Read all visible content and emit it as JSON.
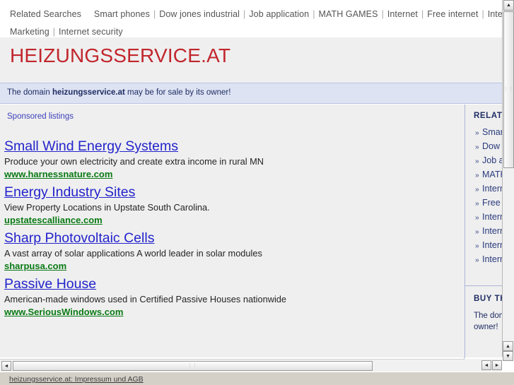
{
  "related_bar": {
    "label": "Related Searches",
    "items": [
      "Smart phones",
      "Dow jones industrial",
      "Job application",
      "MATH GAMES",
      "Internet",
      "Free internet",
      "Internet Serv",
      "Marketing",
      "Internet security"
    ],
    "separator": "|"
  },
  "header": {
    "site_title": "HEIZUNGSSERVICE.AT"
  },
  "notice": {
    "prefix": "The domain ",
    "domain": "heizungsservice.at",
    "suffix": " may be for sale by its owner!"
  },
  "main": {
    "sponsored_label": "Sponsored listings",
    "ads": [
      {
        "title": "Small Wind Energy Systems",
        "description": "Produce your own electricity and create extra income in rural MN",
        "url": "www.harnessnature.com"
      },
      {
        "title": "Energy Industry Sites",
        "description": "View Property Locations in Upstate South Carolina.",
        "url": "upstatescalliance.com"
      },
      {
        "title": "Sharp Photovoltaic Cells",
        "description": "A vast array of solar applications A world leader in solar modules",
        "url": "sharpusa.com"
      },
      {
        "title": "Passive House",
        "description": "American-made windows used in Certified Passive Houses nationwide",
        "url": "www.SeriousWindows.com"
      }
    ]
  },
  "sidebar": {
    "related_title": "RELATED SEARCHES",
    "bullet": "»",
    "items": [
      "Smart phones",
      "Dow jones industrial",
      "Job application",
      "MATH GAMES",
      "Internet",
      "Free internet",
      "Internet Service",
      "Internet Marketing",
      "Internet security",
      "Internet Explorer"
    ],
    "buy_title": "BUY THIS DOMAIN",
    "buy_lines": [
      "The domain may be for sale by its",
      "owner!"
    ]
  },
  "scrollbars": {
    "up_arrow": "▲",
    "down_arrow": "▼",
    "left_arrow": "◄",
    "right_arrow": "►",
    "grip": "⋮⋮"
  },
  "status": {
    "text": "heizungsservice.at: Impressum und AGB"
  },
  "colors": {
    "title_red": "#c1272d",
    "ad_title_blue": "#2323cc",
    "ad_url_green": "#0a7a14",
    "notice_bg": "#dde3f3",
    "page_bg": "#efefef",
    "sidebar_navy": "#1f2d63"
  }
}
